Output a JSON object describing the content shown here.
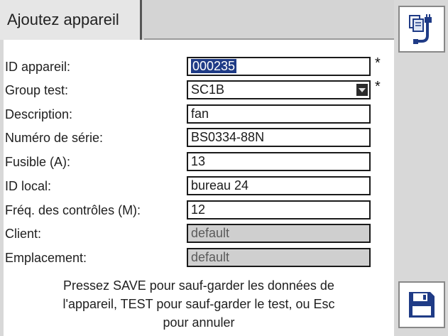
{
  "header": {
    "tab_label": "Ajoutez appareil"
  },
  "form": {
    "fields": [
      {
        "label": "ID appareil:",
        "value": "000235",
        "selected": true,
        "required": true
      },
      {
        "label": "Group test:",
        "value": "SC1B",
        "dropdown": true,
        "required": true
      },
      {
        "label": "Description:",
        "value": "fan"
      },
      {
        "label": "Numéro de série:",
        "value": "BS0334-88N"
      },
      {
        "label": "Fusible (A):",
        "value": "13"
      },
      {
        "label": "ID local:",
        "value": "bureau 24"
      },
      {
        "label": "Fréq. des contrôles (M):",
        "value": "12"
      },
      {
        "label": "Client:",
        "value": "default",
        "disabled": true
      },
      {
        "label": "Emplacement:",
        "value": "default",
        "disabled": true
      }
    ],
    "required_marker": "*"
  },
  "message": {
    "line1": "Pressez SAVE pour sauf-garder les données de",
    "line2": "l'appareil, TEST pour sauf-garder le test, ou Esc",
    "line3": "pour annuler"
  },
  "softkeys": {
    "top_icon": "copy-device-icon",
    "bottom_icon": "floppy-save-icon",
    "accent": "#1f3b86"
  }
}
